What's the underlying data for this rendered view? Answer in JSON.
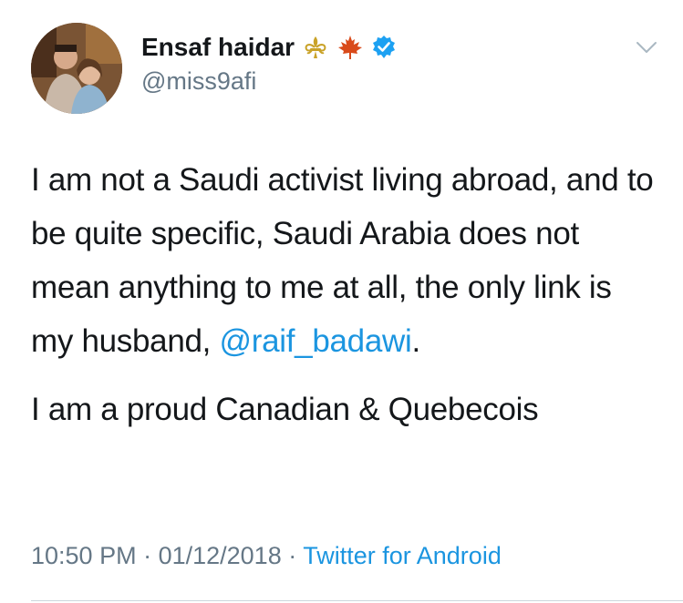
{
  "user": {
    "display_name": "Ensaf haidar",
    "handle": "@miss9afi",
    "name_icons": [
      "fleur-de-lis-icon",
      "maple-leaf-icon",
      "verified-badge-icon"
    ]
  },
  "tweet": {
    "text_before_mention": "I am not a Saudi activist living abroad, and to be quite specific, Saudi Arabia does not mean anything to me at all, the only link is my husband, ",
    "mention": "@raif_badawi",
    "text_after_mention": ".",
    "second_paragraph": "I am a proud Canadian & Quebecois"
  },
  "meta": {
    "time": "10:50 PM",
    "separator": " · ",
    "date": "01/12/2018",
    "source": "Twitter for Android"
  },
  "colors": {
    "link": "#1b95e0",
    "secondary_text": "#657786",
    "primary_text": "#14171a",
    "verified": "#1da1f2",
    "fleur": "#c9a227",
    "maple": "#d94a1a"
  }
}
